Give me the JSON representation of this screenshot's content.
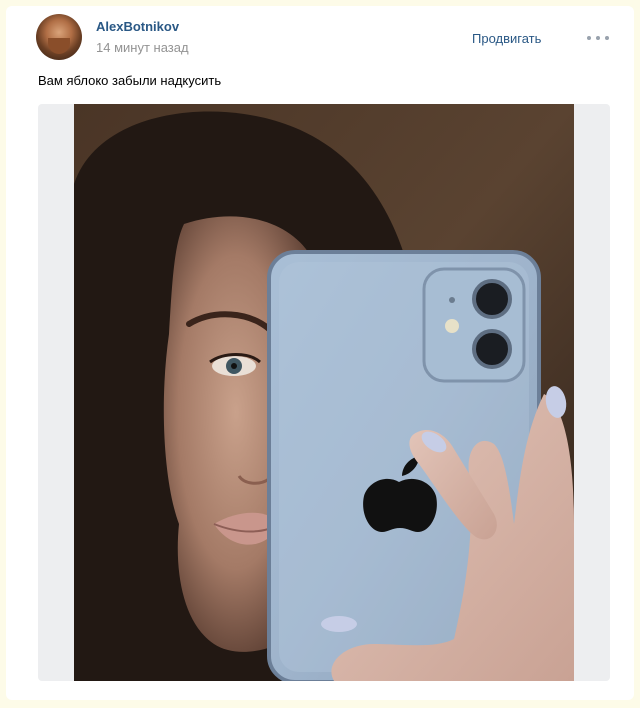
{
  "post": {
    "author": "AlexBotnikov",
    "time": "14 минут назад",
    "promote_label": "Продвигать",
    "text": "Вам яблоко забыли надкусить"
  },
  "colors": {
    "link": "#2a5885",
    "muted": "#939393",
    "page_bg": "#fdfbe8",
    "media_bg": "#edeef0"
  },
  "icons": {
    "more": "more-dots-icon",
    "apple": "apple-logo-icon"
  }
}
